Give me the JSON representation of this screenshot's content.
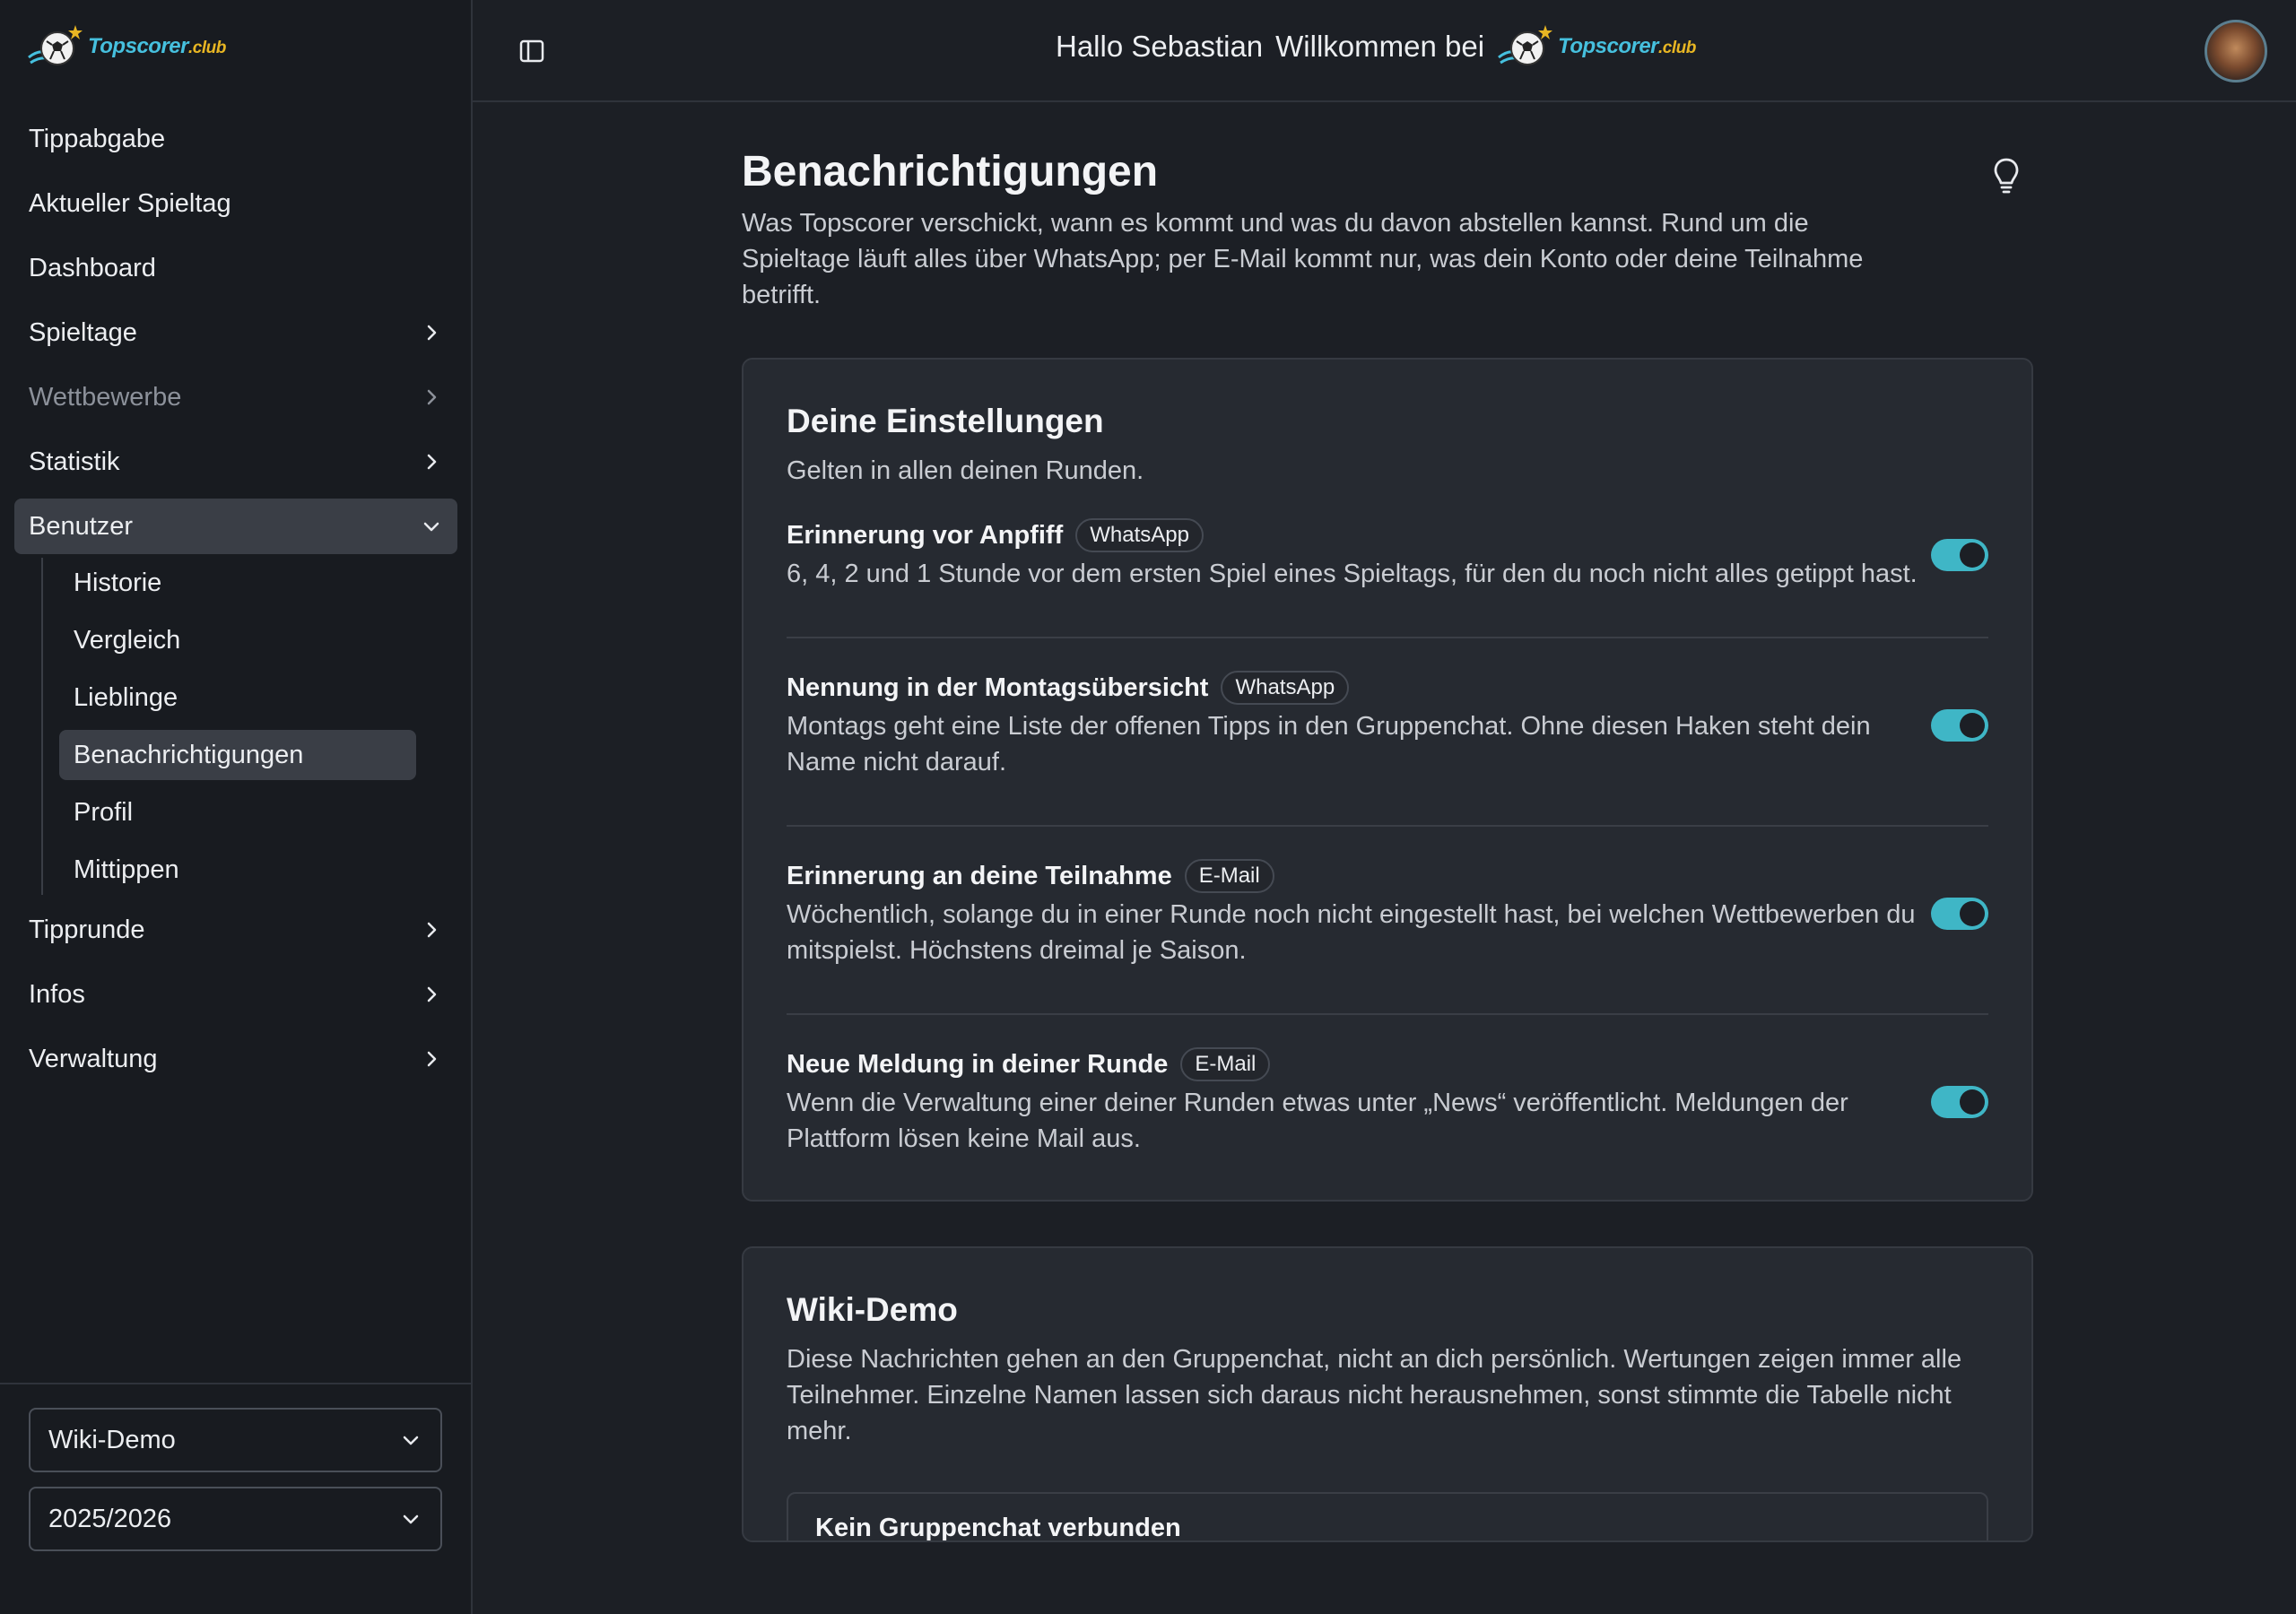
{
  "brand": {
    "name": "Topscorer",
    "suffix": ".club"
  },
  "sidebar": {
    "nav": [
      {
        "label": "Tippabgabe",
        "chevron": false
      },
      {
        "label": "Aktueller Spieltag",
        "chevron": false
      },
      {
        "label": "Dashboard",
        "chevron": false
      },
      {
        "label": "Spieltage",
        "chevron": true
      },
      {
        "label": "Wettbewerbe",
        "chevron": true
      },
      {
        "label": "Statistik",
        "chevron": true
      },
      {
        "label": "Benutzer",
        "chevron": true,
        "expanded": true
      }
    ],
    "subnav": [
      {
        "label": "Historie"
      },
      {
        "label": "Vergleich"
      },
      {
        "label": "Lieblinge"
      },
      {
        "label": "Benachrichtigungen",
        "active": true
      },
      {
        "label": "Profil"
      },
      {
        "label": "Mittippen"
      }
    ],
    "nav_after": [
      {
        "label": "Tipprunde"
      },
      {
        "label": "Infos"
      },
      {
        "label": "Verwaltung"
      }
    ],
    "round_select": "Wiki-Demo",
    "season_select": "2025/2026"
  },
  "topbar": {
    "greeting": "Hallo Sebastian",
    "welcome": "Willkommen bei"
  },
  "page": {
    "title": "Benachrichtigungen",
    "description": "Was Topscorer verschickt, wann es kommt und was du davon abstellen kannst. Rund um die Spieltage läuft alles über WhatsApp; per E-Mail kommt nur, was dein Konto oder deine Teilnahme betrifft."
  },
  "settings_card": {
    "title": "Deine Einstellungen",
    "subtitle": "Gelten in allen deinen Runden.",
    "items": [
      {
        "title": "Erinnerung vor Anpfiff",
        "channel": "WhatsApp",
        "description": "6, 4, 2 und 1 Stunde vor dem ersten Spiel eines Spieltags, für den du noch nicht alles getippt hast.",
        "enabled": true
      },
      {
        "title": "Nennung in der Montagsübersicht",
        "channel": "WhatsApp",
        "description": "Montags geht eine Liste der offenen Tipps in den Gruppenchat. Ohne diesen Haken steht dein Name nicht darauf.",
        "enabled": true
      },
      {
        "title": "Erinnerung an deine Teilnahme",
        "channel": "E-Mail",
        "description": "Wöchentlich, solange du in einer Runde noch nicht eingestellt hast, bei welchen Wettbewerben du mitspielst. Höchstens dreimal je Saison.",
        "enabled": true
      },
      {
        "title": "Neue Meldung in deiner Runde",
        "channel": "E-Mail",
        "description": "Wenn die Verwaltung einer deiner Runden etwas unter „News“ veröffentlicht. Meldungen der Plattform lösen keine Mail aus.",
        "enabled": true
      }
    ]
  },
  "round_card": {
    "title": "Wiki-Demo",
    "description": "Diese Nachrichten gehen an den Gruppenchat, nicht an dich persönlich. Wertungen zeigen immer alle Teilnehmer. Einzelne Namen lassen sich daraus nicht herausnehmen, sonst stimmte die Tabelle nicht mehr.",
    "group_chat_status": "Kein Gruppenchat verbunden"
  },
  "colors": {
    "accent": "#3fb6c6",
    "brand_blue": "#46c0de",
    "brand_gold": "#e8b623"
  }
}
